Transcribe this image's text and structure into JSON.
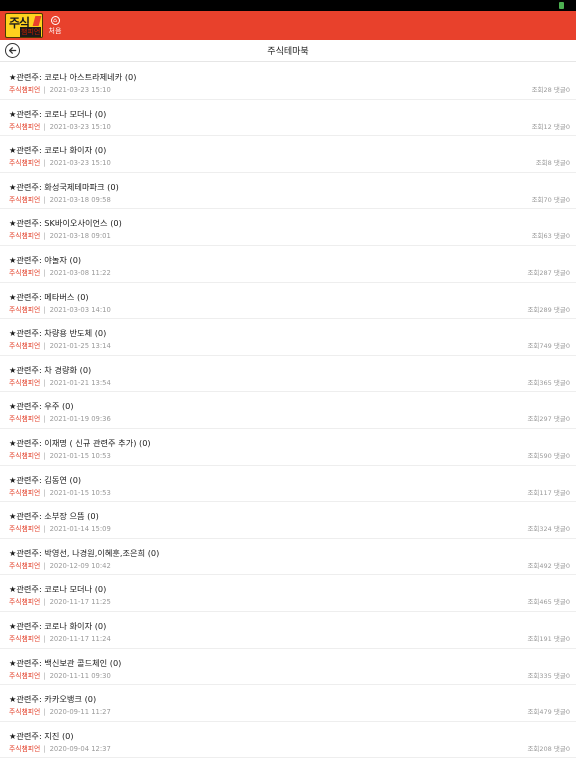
{
  "app": {
    "logo_main": "주식",
    "logo_sub": "챔피언",
    "home_label": "처음"
  },
  "page": {
    "title": "주식테마북"
  },
  "colors": {
    "appbar": "#e8412c",
    "author": "#e3402a"
  },
  "icons": {
    "back": "back-arrow-icon",
    "home": "home-icon"
  },
  "posts": [
    {
      "title": "★관련주: 코로나 아스트라제네카 (0)",
      "author": "주식챔피언",
      "sep": "|",
      "date": "2021-03-23 15:10",
      "views": "조회28",
      "comments": "댓글0"
    },
    {
      "title": "★관련주: 코로나 모더나 (0)",
      "author": "주식챔피언",
      "sep": "|",
      "date": "2021-03-23 15:10",
      "views": "조회12",
      "comments": "댓글0"
    },
    {
      "title": "★관련주: 코로나 화이자 (0)",
      "author": "주식챔피언",
      "sep": "|",
      "date": "2021-03-23 15:10",
      "views": "조회8",
      "comments": "댓글0"
    },
    {
      "title": "★관련주: 화성국제테마파크 (0)",
      "author": "주식챔피언",
      "sep": "|",
      "date": "2021-03-18 09:58",
      "views": "조회70",
      "comments": "댓글0"
    },
    {
      "title": "★관련주: SK바이오사이언스 (0)",
      "author": "주식챔피언",
      "sep": "|",
      "date": "2021-03-18 09:01",
      "views": "조회63",
      "comments": "댓글0"
    },
    {
      "title": "★관련주: 야놀자 (0)",
      "author": "주식챔피언",
      "sep": "|",
      "date": "2021-03-08 11:22",
      "views": "조회287",
      "comments": "댓글0"
    },
    {
      "title": "★관련주: 메타버스 (0)",
      "author": "주식챔피언",
      "sep": "|",
      "date": "2021-03-03 14:10",
      "views": "조회289",
      "comments": "댓글0"
    },
    {
      "title": "★관련주: 차량용 반도체 (0)",
      "author": "주식챔피언",
      "sep": "|",
      "date": "2021-01-25 13:14",
      "views": "조회749",
      "comments": "댓글0"
    },
    {
      "title": "★관련주: 차 경량화 (0)",
      "author": "주식챔피언",
      "sep": "|",
      "date": "2021-01-21 13:54",
      "views": "조회365",
      "comments": "댓글0"
    },
    {
      "title": "★관련주: 우주 (0)",
      "author": "주식챔피언",
      "sep": "|",
      "date": "2021-01-19 09:36",
      "views": "조회297",
      "comments": "댓글0"
    },
    {
      "title": "★관련주: 이재명 ( 신규 관련주 추가) (0)",
      "author": "주식챔피언",
      "sep": "|",
      "date": "2021-01-15 10:53",
      "views": "조회590",
      "comments": "댓글0"
    },
    {
      "title": "★관련주: 김동연 (0)",
      "author": "주식챔피언",
      "sep": "|",
      "date": "2021-01-15 10:53",
      "views": "조회117",
      "comments": "댓글0"
    },
    {
      "title": "★관련주: 소부장 으뜸 (0)",
      "author": "주식챔피언",
      "sep": "|",
      "date": "2021-01-14 15:09",
      "views": "조회324",
      "comments": "댓글0"
    },
    {
      "title": "★관련주: 박영선, 나경원,이혜훈,조은희 (0)",
      "author": "주식챔피언",
      "sep": "|",
      "date": "2020-12-09 10:42",
      "views": "조회492",
      "comments": "댓글0"
    },
    {
      "title": "★관련주: 코로나 모더나 (0)",
      "author": "주식챔피언",
      "sep": "|",
      "date": "2020-11-17 11:25",
      "views": "조회465",
      "comments": "댓글0"
    },
    {
      "title": "★관련주: 코로나 화이자 (0)",
      "author": "주식챔피언",
      "sep": "|",
      "date": "2020-11-17 11:24",
      "views": "조회191",
      "comments": "댓글0"
    },
    {
      "title": "★관련주: 백신보관 콜드체인 (0)",
      "author": "주식챔피언",
      "sep": "|",
      "date": "2020-11-11 09:30",
      "views": "조회335",
      "comments": "댓글0"
    },
    {
      "title": "★관련주: 카카오뱅크 (0)",
      "author": "주식챔피언",
      "sep": "|",
      "date": "2020-09-11 11:27",
      "views": "조회479",
      "comments": "댓글0"
    },
    {
      "title": "★관련주: 지진 (0)",
      "author": "주식챔피언",
      "sep": "|",
      "date": "2020-09-04 12:37",
      "views": "조회208",
      "comments": "댓글0"
    }
  ]
}
